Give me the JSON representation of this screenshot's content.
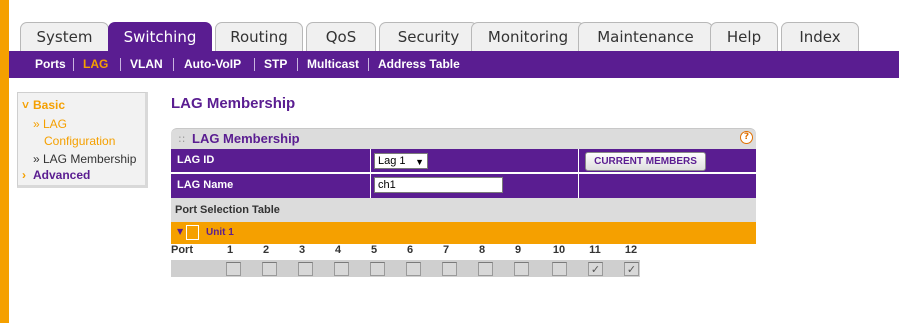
{
  "tabs": [
    {
      "label": "System",
      "active": false
    },
    {
      "label": "Switching",
      "active": true
    },
    {
      "label": "Routing",
      "active": false
    },
    {
      "label": "QoS",
      "active": false
    },
    {
      "label": "Security",
      "active": false
    },
    {
      "label": "Monitoring",
      "active": false
    },
    {
      "label": "Maintenance",
      "active": false
    },
    {
      "label": "Help",
      "active": false
    },
    {
      "label": "Index",
      "active": false
    }
  ],
  "subnav": [
    {
      "label": "Ports",
      "active": false
    },
    {
      "label": "LAG",
      "active": true
    },
    {
      "label": "VLAN",
      "active": false
    },
    {
      "label": "Auto-VoIP",
      "active": false
    },
    {
      "label": "STP",
      "active": false
    },
    {
      "label": "Multicast",
      "active": false
    },
    {
      "label": "Address Table",
      "active": false
    }
  ],
  "leftnav": {
    "basic": "Basic",
    "basic_marker": "»",
    "lag_config_line1": "» LAG",
    "lag_config_line2": "Configuration",
    "lag_membership": "» LAG Membership",
    "advanced": "Advanced",
    "advanced_marker": "›"
  },
  "page_title": "LAG Membership",
  "panel": {
    "title": "LAG Membership",
    "help": "?",
    "lag_id_label": "LAG ID",
    "lag_id_value": "Lag 1",
    "lag_name_label": "LAG Name",
    "lag_name_value": "ch1",
    "current_members_button": "CURRENT MEMBERS",
    "port_selection_label": "Port Selection Table",
    "unit_label": "Unit 1",
    "port_label": "Port",
    "ports": [
      "1",
      "2",
      "3",
      "4",
      "5",
      "6",
      "7",
      "8",
      "9",
      "10",
      "11",
      "12"
    ],
    "checked_ports": [
      "11",
      "12"
    ],
    "checkmark": "✓"
  },
  "colors": {
    "brand_purple": "#5a1d91",
    "accent_orange": "#f5a000"
  }
}
